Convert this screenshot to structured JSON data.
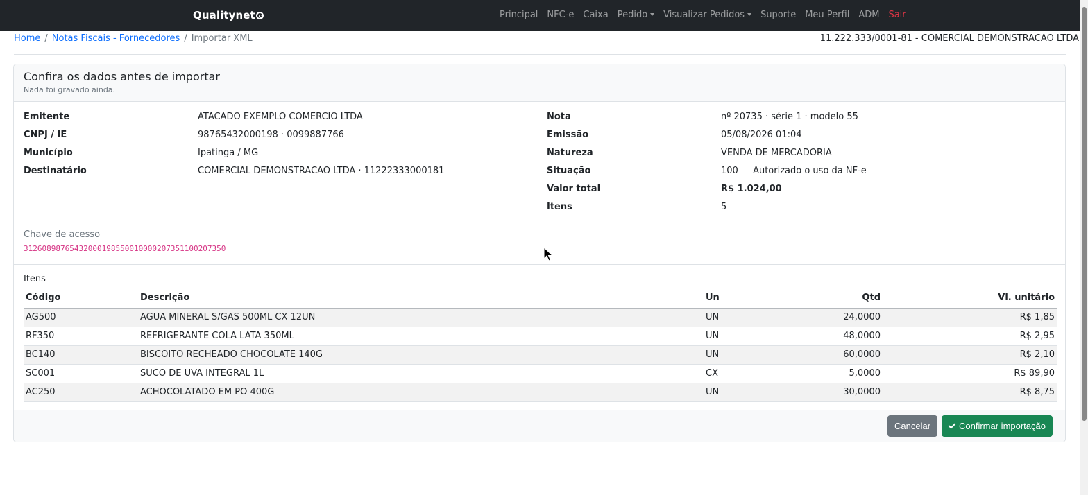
{
  "navbar": {
    "brand": "Qualitynet",
    "items": [
      {
        "label": "Principal"
      },
      {
        "label": "NFC-e"
      },
      {
        "label": "Caixa"
      },
      {
        "label": "Pedido",
        "dropdown": true
      },
      {
        "label": "Visualizar Pedidos",
        "dropdown": true
      },
      {
        "label": "Suporte"
      },
      {
        "label": "Meu Perfil"
      },
      {
        "label": "ADM"
      },
      {
        "label": "Sair"
      }
    ]
  },
  "breadcrumb": {
    "home": "Home",
    "notas": "Notas Fiscais - Fornecedores",
    "current": "Importar XML"
  },
  "company": "11.222.333/0001-81 - COMERCIAL DEMONSTRACAO LTDA",
  "card": {
    "title": "Confira os dados antes de importar",
    "subtitle": "Nada foi gravado ainda."
  },
  "left_fields": {
    "emitente_label": "Emitente",
    "emitente": "ATACADO EXEMPLO COMERCIO LTDA",
    "cnpj_label": "CNPJ / IE",
    "cnpj": "98765432000198 · 0099887766",
    "municipio_label": "Município",
    "municipio": "Ipatinga / MG",
    "destinatario_label": "Destinatário",
    "destinatario": "COMERCIAL DEMONSTRACAO LTDA · 11222333000181"
  },
  "right_fields": {
    "nota_label": "Nota",
    "nota": "nº 20735 · série 1 · modelo 55",
    "emissao_label": "Emissão",
    "emissao": "05/08/2026 01:04",
    "natureza_label": "Natureza",
    "natureza": "VENDA DE MERCADORIA",
    "situacao_label": "Situação",
    "situacao": "100 — Autorizado o uso da NF-e",
    "valor_label": "Valor total",
    "valor": "R$ 1.024,00",
    "itens_label": "Itens",
    "itens": "5"
  },
  "chave": {
    "label": "Chave de acesso",
    "value": "31260898765432000198550010000207351100207350"
  },
  "items": {
    "title": "Itens",
    "headers": {
      "codigo": "Código",
      "descricao": "Descrição",
      "un": "Un",
      "qtd": "Qtd",
      "vl_unitario": "Vl. unitário"
    },
    "rows": [
      {
        "codigo": "AG500",
        "descricao": "AGUA MINERAL S/GAS 500ML CX 12UN",
        "un": "UN",
        "qtd": "24,0000",
        "vl": "R$ 1,85"
      },
      {
        "codigo": "RF350",
        "descricao": "REFRIGERANTE COLA LATA 350ML",
        "un": "UN",
        "qtd": "48,0000",
        "vl": "R$ 2,95"
      },
      {
        "codigo": "BC140",
        "descricao": "BISCOITO RECHEADO CHOCOLATE 140G",
        "un": "UN",
        "qtd": "60,0000",
        "vl": "R$ 2,10"
      },
      {
        "codigo": "SC001",
        "descricao": "SUCO DE UVA INTEGRAL 1L",
        "un": "CX",
        "qtd": "5,0000",
        "vl": "R$ 89,90"
      },
      {
        "codigo": "AC250",
        "descricao": "ACHOCOLATADO EM PO 400G",
        "un": "UN",
        "qtd": "30,0000",
        "vl": "R$ 8,75"
      }
    ]
  },
  "buttons": {
    "cancel": "Cancelar",
    "confirm": "Confirmar importação"
  },
  "colors": {
    "navbar_bg": "#212529",
    "sair": "#dc3545",
    "link": "#0d6efd",
    "chave": "#d63384",
    "confirm": "#198754",
    "cancel": "#6c757d"
  }
}
